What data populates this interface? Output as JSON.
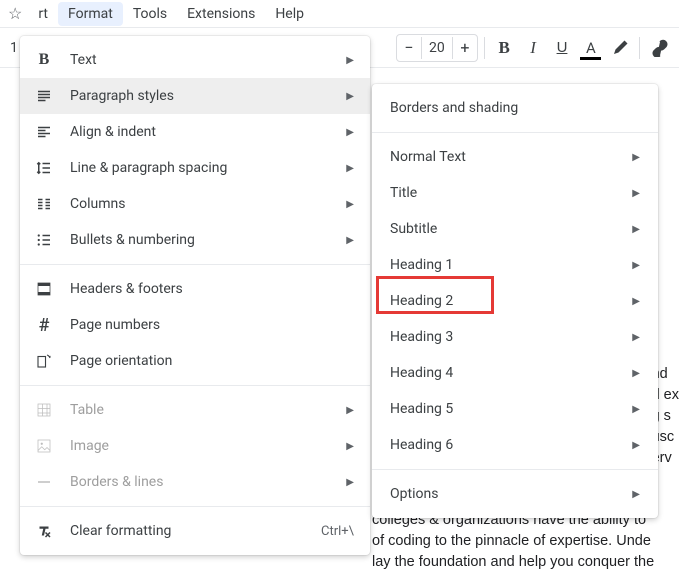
{
  "menubar": {
    "items": [
      "rt",
      "Format",
      "Tools",
      "Extensions",
      "Help"
    ],
    "active": "Format"
  },
  "toolbar": {
    "fontsize": "20"
  },
  "format_menu": {
    "section1": [
      {
        "label": "Text",
        "icon": "bold"
      },
      {
        "label": "Paragraph styles",
        "icon": "paragraph",
        "highlighted": true
      },
      {
        "label": "Align & indent",
        "icon": "align"
      },
      {
        "label": "Line & paragraph spacing",
        "icon": "line-spacing"
      },
      {
        "label": "Columns",
        "icon": "columns"
      },
      {
        "label": "Bullets & numbering",
        "icon": "bullets"
      }
    ],
    "section2": [
      {
        "label": "Headers & footers",
        "icon": "headers"
      },
      {
        "label": "Page numbers",
        "icon": "hash"
      },
      {
        "label": "Page orientation",
        "icon": "orientation"
      }
    ],
    "section3": [
      {
        "label": "Table",
        "icon": "table",
        "disabled": true
      },
      {
        "label": "Image",
        "icon": "image",
        "disabled": true
      },
      {
        "label": "Borders & lines",
        "icon": "hline",
        "disabled": true
      }
    ],
    "section4": [
      {
        "label": "Clear formatting",
        "icon": "clear",
        "shortcut": "Ctrl+\\"
      }
    ]
  },
  "styles_submenu": {
    "top": [
      {
        "label": "Borders and shading"
      }
    ],
    "middle": [
      {
        "label": "Normal Text"
      },
      {
        "label": "Title"
      },
      {
        "label": "Subtitle"
      },
      {
        "label": "Heading 1"
      },
      {
        "label": "Heading 2"
      },
      {
        "label": "Heading 3"
      },
      {
        "label": "Heading 4"
      },
      {
        "label": "Heading 5"
      },
      {
        "label": "Heading 6"
      }
    ],
    "bottom": [
      {
        "label": "Options"
      }
    ]
  },
  "doc_text_lines": [
    "nd",
    "d ex",
    "g s",
    "usc",
    "erv",
    "colleges & organizations nave the ability to",
    "of coding to the pinnacle of expertise. Unde",
    "lay the foundation and help you conquer the"
  ],
  "highlight": {
    "target": "Heading 2"
  }
}
